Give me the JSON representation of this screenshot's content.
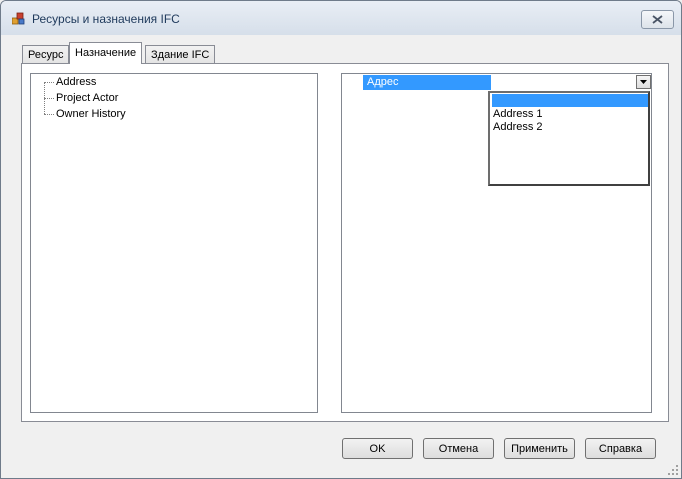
{
  "window": {
    "title": "Ресурсы и назначения IFC",
    "icon": "app-icon",
    "close_icon": "close-icon"
  },
  "tabs": [
    {
      "label": "Ресурс",
      "active": false
    },
    {
      "label": "Назначение",
      "active": true
    },
    {
      "label": "Здание IFC",
      "active": false
    }
  ],
  "tree": {
    "items": [
      "Address",
      "Project Actor",
      "Owner History"
    ]
  },
  "property_grid": {
    "row_label": "Адрес",
    "row_value": "",
    "dropdown_options": [
      "",
      "Address 1",
      "Address 2"
    ],
    "selected_index": 0
  },
  "buttons": {
    "ok": "OK",
    "cancel": "Отмена",
    "apply": "Применить",
    "help": "Справка"
  },
  "colors": {
    "selection": "#3399ff",
    "title_text": "#1e395b"
  }
}
